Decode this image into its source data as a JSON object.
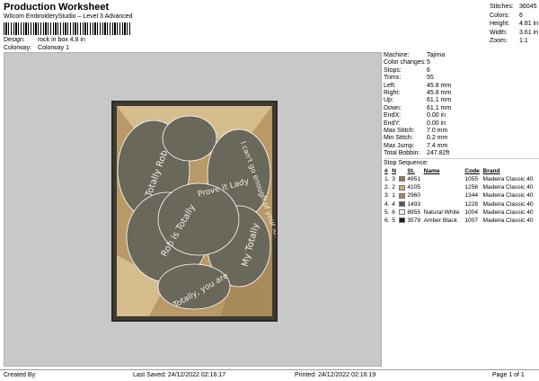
{
  "header": {
    "title": "Production Worksheet",
    "subtitle": "Wilcom EmbroideryStudio – Level 3 Advanced",
    "design_label": "Design:",
    "design_value": "rock in box 4,8 in",
    "colorway_label": "Colorway:",
    "colorway_value": "Colorway 1"
  },
  "stats": [
    {
      "k": "Stitches:",
      "v": "36045"
    },
    {
      "k": "Colors:",
      "v": "6"
    },
    {
      "k": "Height:",
      "v": "4.81 in"
    },
    {
      "k": "Width:",
      "v": "3.61 in"
    },
    {
      "k": "Zoom:",
      "v": "1:1"
    }
  ],
  "machine": [
    {
      "k": "Machine:",
      "v": "Tajima"
    },
    {
      "k": "Color changes:",
      "v": "5"
    },
    {
      "k": "Stops:",
      "v": "6"
    },
    {
      "k": "Trims:",
      "v": "55"
    },
    {
      "k": "Left:",
      "v": "45.8 mm"
    },
    {
      "k": "Right:",
      "v": "45.8 mm"
    },
    {
      "k": "Up:",
      "v": "61.1 mm"
    },
    {
      "k": "Down:",
      "v": "61.1 mm"
    },
    {
      "k": "EndX:",
      "v": "0.00 in"
    },
    {
      "k": "EndY:",
      "v": "0.00 in"
    },
    {
      "k": "Max Stitch:",
      "v": "7.0 mm"
    },
    {
      "k": "Min Stitch:",
      "v": "0.2 mm"
    },
    {
      "k": "Max Jump:",
      "v": "7.4 mm"
    },
    {
      "k": "Total Bobbin:",
      "v": "247.82ft"
    }
  ],
  "sequence": {
    "title": "Stop Sequence:",
    "headers": [
      "#",
      "N",
      "St.",
      "Name",
      "Code",
      "Brand"
    ],
    "rows": [
      {
        "idx": "1.",
        "n": "3",
        "color": "#8f7a58",
        "st": "4951",
        "name": "",
        "code": "1055",
        "brand": "Madeira Classic 40"
      },
      {
        "idx": "2.",
        "n": "2",
        "color": "#c9a776",
        "st": "4105",
        "name": "",
        "code": "1256",
        "brand": "Madeira Classic 40"
      },
      {
        "idx": "3.",
        "n": "1",
        "color": "#a08a6b",
        "st": "2960",
        "name": "",
        "code": "1344",
        "brand": "Madeira Classic 40"
      },
      {
        "idx": "4.",
        "n": "4",
        "color": "#5b5548",
        "st": "1493",
        "name": "",
        "code": "1228",
        "brand": "Madeira Classic 40"
      },
      {
        "idx": "5.",
        "n": "6",
        "color": "#f3f3f3",
        "st": "8955",
        "name": "Natural White",
        "code": "1004",
        "brand": "Madeira Classic 40"
      },
      {
        "idx": "6.",
        "n": "5",
        "color": "#1c1c1c",
        "st": "3579",
        "name": "Amber Black",
        "code": "1007",
        "brand": "Madeira Classic 40"
      }
    ]
  },
  "design_colors": {
    "frame": "#3e3b33",
    "box": "#b99a66",
    "box_light": "#d6bd8e",
    "rock": "#6a675b",
    "rock_edge": "#ffffff",
    "text": "#f0efe8"
  },
  "rock_texts": [
    "Totally Rob",
    "I can't go enough of your lovely Rock",
    "Prove it Lady",
    "Rob is Totally",
    "My Totally",
    "Totally, you are"
  ],
  "footer": {
    "created_by": "Created By:",
    "last_saved": "Last Saved: 24/12/2022 02:16:17",
    "printed": "Printed: 24/12/2022 02:16:19",
    "page": "Page 1 of 1"
  }
}
